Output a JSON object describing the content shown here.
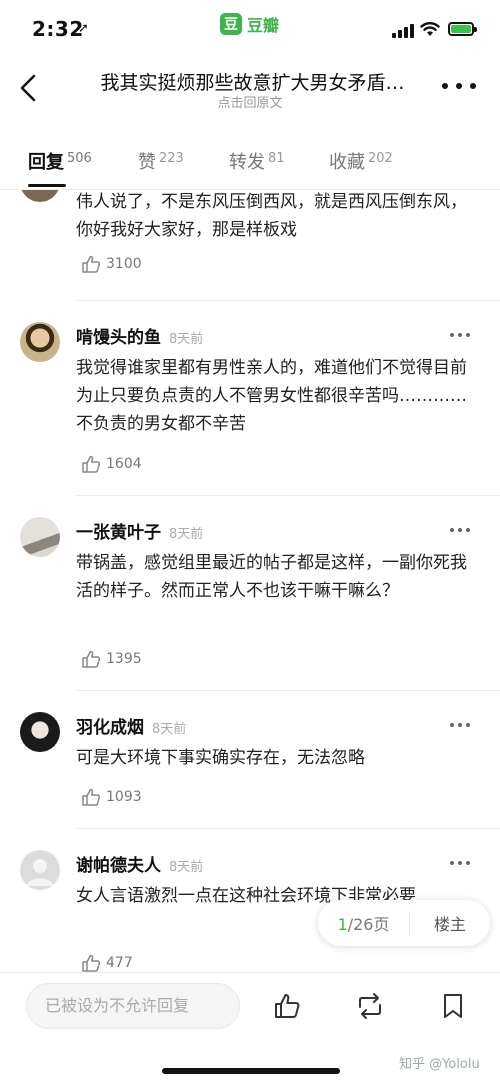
{
  "status_bar": {
    "time": "2:32",
    "location_glyph": "➚",
    "app_logo_char": "豆",
    "app_name": "豆瓣",
    "battery_color": "#3cc24a"
  },
  "nav": {
    "title": "我其实挺烦那些故意扩大男女矛盾…",
    "subtitle": "点击回原文"
  },
  "tabs": [
    {
      "label": "回复",
      "count": "506"
    },
    {
      "label": "赞",
      "count": "223"
    },
    {
      "label": "转发",
      "count": "81"
    },
    {
      "label": "收藏",
      "count": "202"
    }
  ],
  "comments": [
    {
      "text": "伟人说了，不是东风压倒西风，就是西风压倒东风，你好我好大家好，那是样板戏",
      "likes": "3100"
    },
    {
      "user": "啃馒头的鱼",
      "time": "8天前",
      "text": "我觉得谁家里都有男性亲人的，难道他们不觉得目前为止只要负点责的人不管男女性都很辛苦吗…………不负责的男女都不辛苦",
      "likes": "1604"
    },
    {
      "user": "一张黄叶子",
      "time": "8天前",
      "text": "带锅盖，感觉组里最近的帖子都是这样，一副你死我活的样子。然而正常人不也该干嘛干嘛么？",
      "likes": "1395"
    },
    {
      "user": "羽化成烟",
      "time": "8天前",
      "text": "可是大环境下事实确实存在，无法忽略",
      "likes": "1093"
    },
    {
      "user": "谢帕德夫人",
      "time": "8天前",
      "text": "女人言语激烈一点在这种社会环境下非常必要",
      "likes": "477"
    }
  ],
  "pager": {
    "current": "1",
    "total_suffix": "/26页",
    "op_label": "楼主"
  },
  "bottom": {
    "reply_placeholder": "已被设为不允许回复"
  },
  "watermark": "知乎 @Yololu",
  "accent_color": "#3cb64a"
}
